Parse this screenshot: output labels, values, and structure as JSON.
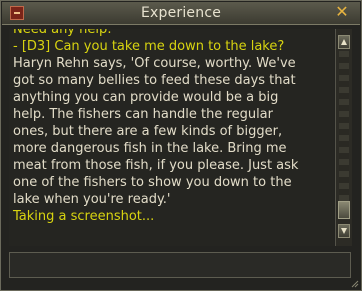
{
  "window": {
    "title": "Experience",
    "close_label": "✕"
  },
  "chat": {
    "lines": [
      {
        "text": "Need any help:",
        "color": "yellow"
      },
      {
        "text": "- [D3] Can you take me down to the lake?",
        "color": "yellow"
      },
      {
        "text": "Haryn Rehn says, 'Of course, worthy. We've",
        "color": "white"
      },
      {
        "text": "got so many bellies to feed these days that",
        "color": "white"
      },
      {
        "text": "anything you can provide would be a big",
        "color": "white"
      },
      {
        "text": "help. The fishers can handle the regular",
        "color": "white"
      },
      {
        "text": "ones, but there are a few kinds of bigger,",
        "color": "white"
      },
      {
        "text": "more dangerous fish in the lake. Bring me",
        "color": "white"
      },
      {
        "text": "meat from those fish, if you please. Just ask",
        "color": "white"
      },
      {
        "text": "one of the fishers to show you down to the",
        "color": "white"
      },
      {
        "text": "lake when you're ready.'",
        "color": "white"
      },
      {
        "text": "Taking a screenshot...",
        "color": "yellow"
      }
    ]
  },
  "input": {
    "value": ""
  },
  "colors": {
    "yellow_text": "#d8d410",
    "white_text": "#e2dcc8",
    "close_icon": "#e8b440"
  }
}
